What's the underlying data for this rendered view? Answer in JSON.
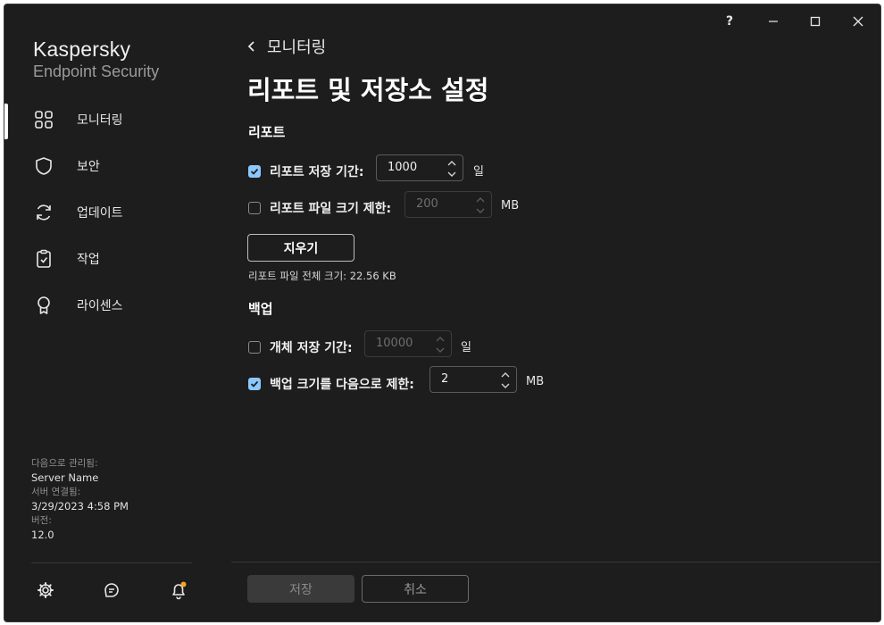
{
  "brand": {
    "line1": "Kaspersky",
    "line2": "Endpoint Security"
  },
  "titlebar": {
    "help": "?"
  },
  "sidebar": {
    "items": [
      {
        "label": "모니터링",
        "icon": "grid-icon",
        "active": true
      },
      {
        "label": "보안",
        "icon": "shield-icon",
        "active": false
      },
      {
        "label": "업데이트",
        "icon": "refresh-icon",
        "active": false
      },
      {
        "label": "작업",
        "icon": "clipboard-icon",
        "active": false
      },
      {
        "label": "라이센스",
        "icon": "badge-icon",
        "active": false
      }
    ],
    "meta": {
      "managed_by_label": "다음으로 관리됨:",
      "managed_by_value": "Server Name",
      "server_conn_label": "서버 연결됨:",
      "server_conn_value": "3/29/2023 4:58 PM",
      "version_label": "버전:",
      "version_value": "12.0"
    },
    "bottom_icons": [
      "gear-icon",
      "support-icon",
      "bell-icon"
    ]
  },
  "main": {
    "back_label": "모니터링",
    "title": "리포트 및 저장소 설정",
    "reports": {
      "heading": "리포트",
      "retention": {
        "checked": true,
        "label": "리포트 저장 기간:",
        "value": "1000",
        "unit": "일"
      },
      "file_limit": {
        "checked": false,
        "label": "리포트 파일 크기 제한:",
        "value": "200",
        "unit": "MB"
      },
      "clear_button": "지우기",
      "size_note": "리포트 파일 전체 크기: 22.56 KB"
    },
    "backup": {
      "heading": "백업",
      "object_retention": {
        "checked": false,
        "label": "개체 저장 기간:",
        "value": "10000",
        "unit": "일"
      },
      "size_limit": {
        "checked": true,
        "label": "백업 크기를 다음으로 제한:",
        "value": "2",
        "unit": "MB"
      }
    }
  },
  "footer": {
    "save": "저장",
    "cancel": "취소"
  },
  "colors": {
    "accent": "#8cc8ff",
    "notification": "#f5a623",
    "background": "#1d1d1d"
  }
}
